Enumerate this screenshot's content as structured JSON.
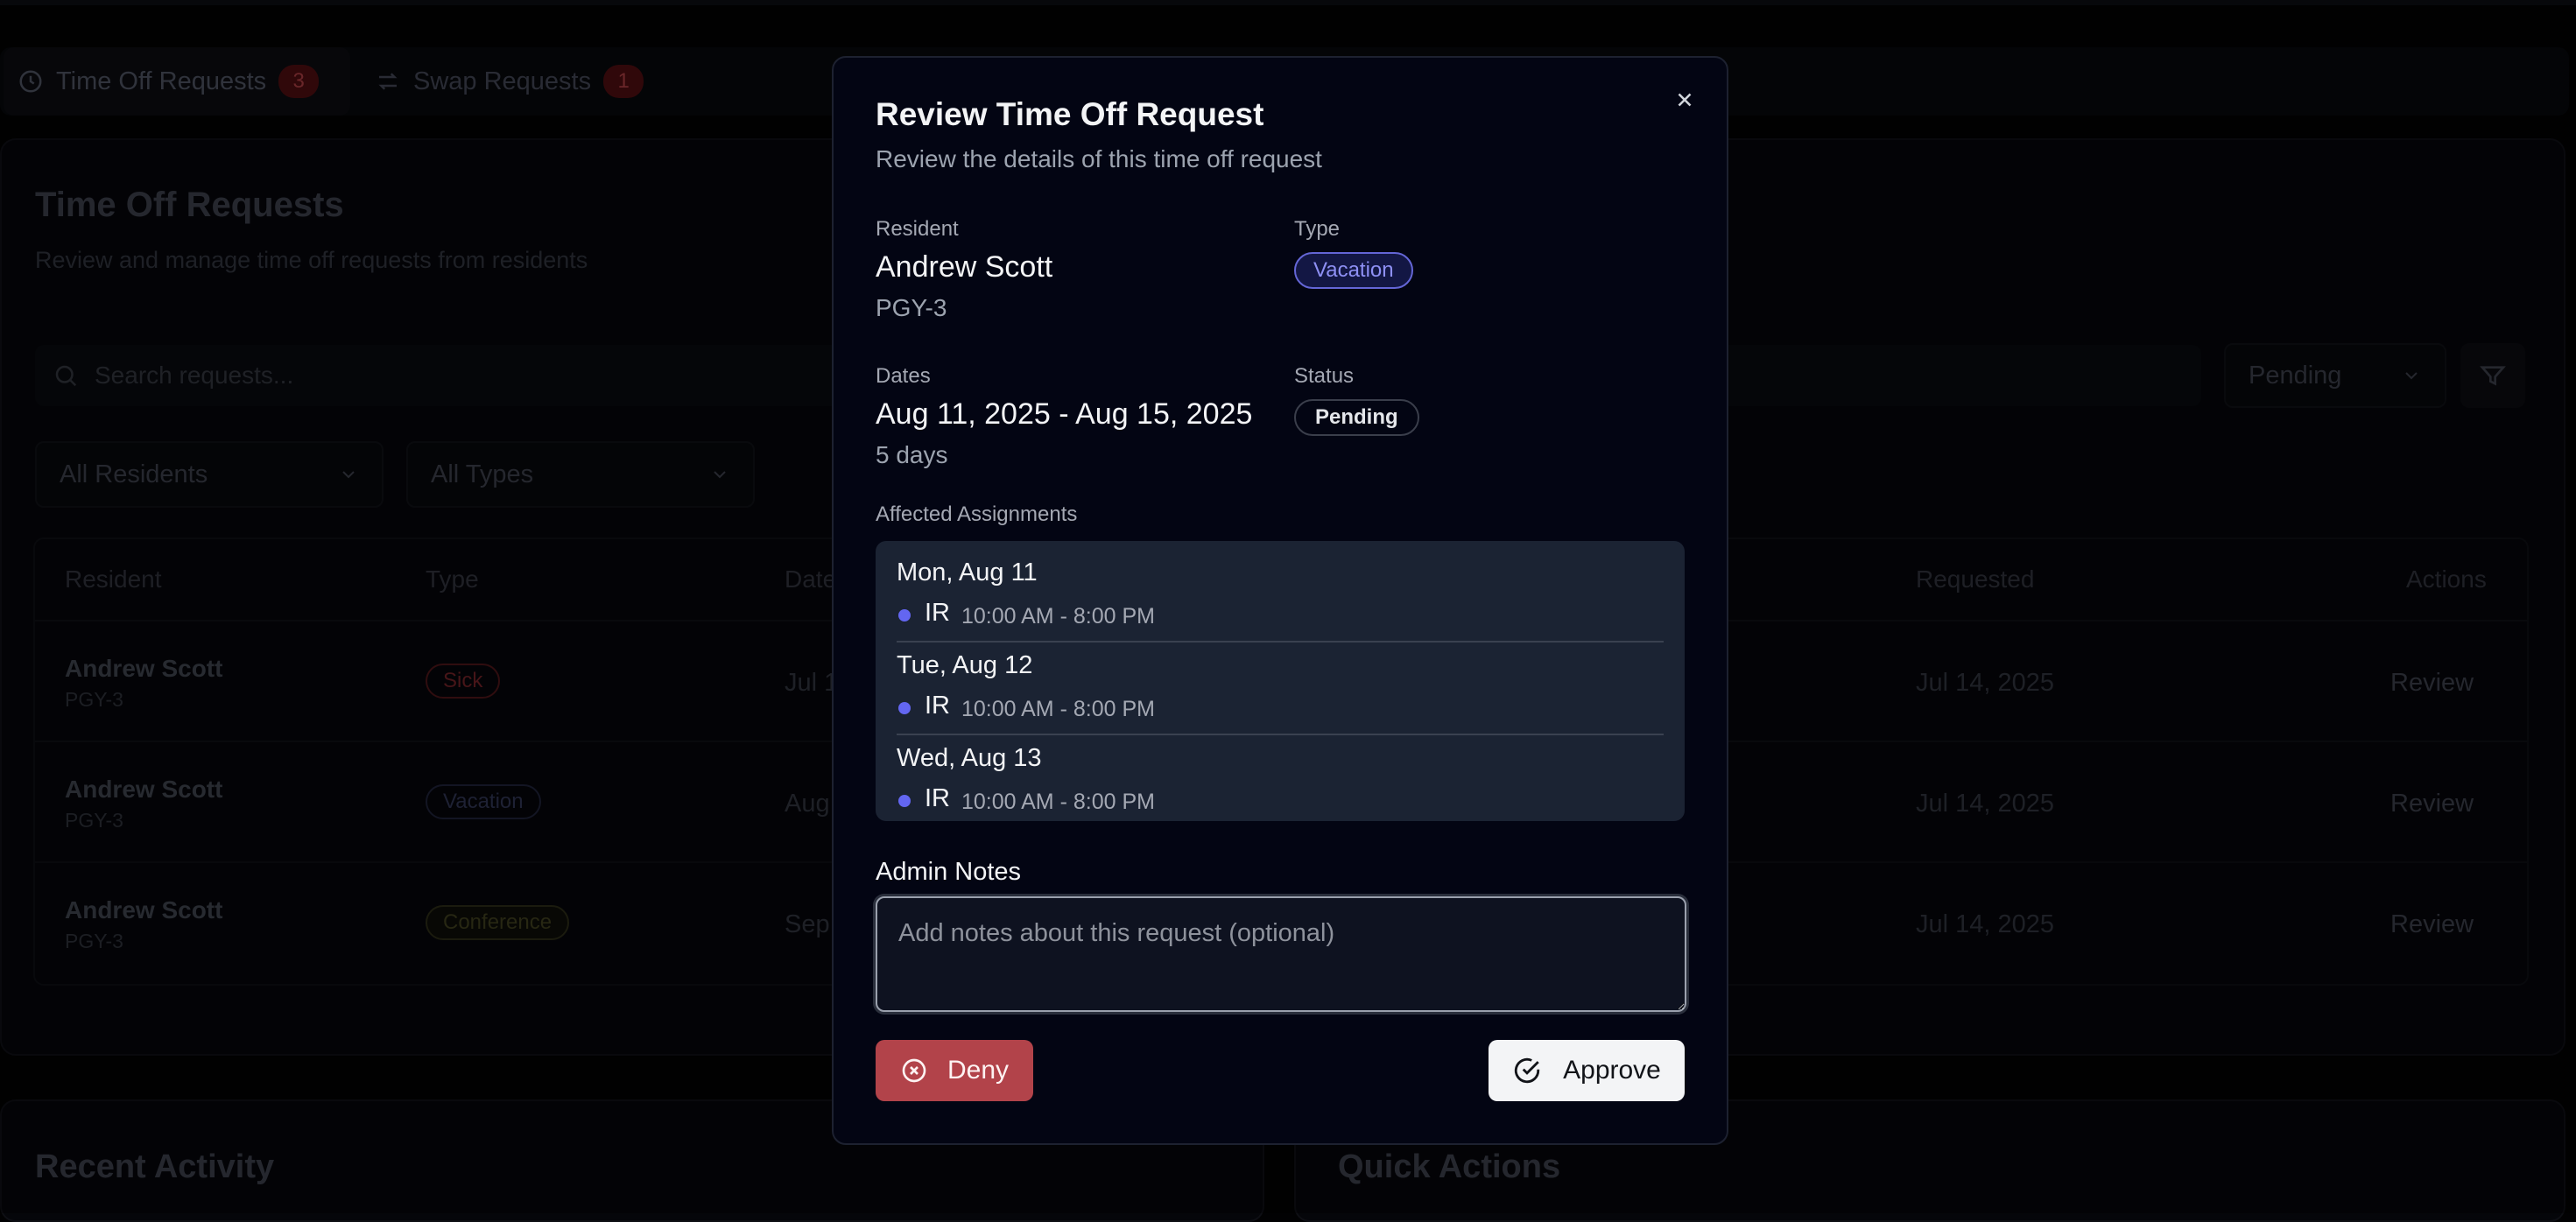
{
  "tabs": [
    {
      "label": "Time Off Requests",
      "count": "3"
    },
    {
      "label": "Swap Requests",
      "count": "1"
    }
  ],
  "page": {
    "title": "Time Off Requests",
    "subtitle": "Review and manage time off requests from residents"
  },
  "search": {
    "placeholder": "Search requests..."
  },
  "filters": {
    "status": "Pending",
    "residents": "All Residents",
    "types": "All Types"
  },
  "table": {
    "headers": {
      "resident": "Resident",
      "type": "Type",
      "dates": "Date",
      "requested": "Requested",
      "actions": "Actions"
    },
    "rows": [
      {
        "name": "Andrew Scott",
        "pgy": "PGY-3",
        "type": "Sick",
        "dates": "Jul 1",
        "requested": "Jul 14, 2025",
        "action": "Review"
      },
      {
        "name": "Andrew Scott",
        "pgy": "PGY-3",
        "type": "Vacation",
        "dates": "Aug",
        "requested": "Jul 14, 2025",
        "action": "Review"
      },
      {
        "name": "Andrew Scott",
        "pgy": "PGY-3",
        "type": "Conference",
        "dates": "Sep",
        "requested": "Jul 14, 2025",
        "action": "Review"
      }
    ]
  },
  "bottom": {
    "recent_title": "Recent Activity",
    "quick_title": "Quick Actions"
  },
  "modal": {
    "title": "Review Time Off Request",
    "subtitle": "Review the details of this time off request",
    "resident_label": "Resident",
    "resident_name": "Andrew Scott",
    "resident_pgy": "PGY-3",
    "type_label": "Type",
    "type_value": "Vacation",
    "dates_label": "Dates",
    "dates_value": "Aug 11, 2025 - Aug 15, 2025",
    "days": "5 days",
    "status_label": "Status",
    "status_value": "Pending",
    "affected_label": "Affected Assignments",
    "assignments": [
      {
        "day": "Mon, Aug 11",
        "code": "IR",
        "time": "10:00 AM - 8:00 PM"
      },
      {
        "day": "Tue, Aug 12",
        "code": "IR",
        "time": "10:00 AM - 8:00 PM"
      },
      {
        "day": "Wed, Aug 13",
        "code": "IR",
        "time": "10:00 AM - 8:00 PM"
      }
    ],
    "notes_label": "Admin Notes",
    "notes_placeholder": "Add notes about this request (optional)",
    "notes_value": "",
    "deny_label": "Deny",
    "approve_label": "Approve"
  },
  "colors": {
    "accent": "#6366f1",
    "deny": "#b2434a",
    "vacation_badge": "#8e90f4"
  }
}
